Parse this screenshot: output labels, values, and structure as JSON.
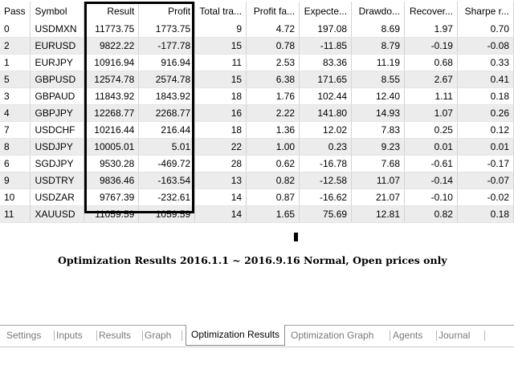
{
  "columns": [
    "Pass",
    "Symbol",
    "Result",
    "Profit",
    "Total tra...",
    "Profit fa...",
    "Expecte...",
    "Drawdo...",
    "Recover...",
    "Sharpe r..."
  ],
  "rows": [
    [
      "0",
      "USDMXN",
      "11773.75",
      "1773.75",
      "9",
      "4.72",
      "197.08",
      "8.69",
      "1.97",
      "0.70"
    ],
    [
      "2",
      "EURUSD",
      "9822.22",
      "-177.78",
      "15",
      "0.78",
      "-11.85",
      "8.79",
      "-0.19",
      "-0.08"
    ],
    [
      "1",
      "EURJPY",
      "10916.94",
      "916.94",
      "11",
      "2.53",
      "83.36",
      "11.19",
      "0.68",
      "0.33"
    ],
    [
      "5",
      "GBPUSD",
      "12574.78",
      "2574.78",
      "15",
      "6.38",
      "171.65",
      "8.55",
      "2.67",
      "0.41"
    ],
    [
      "3",
      "GBPAUD",
      "11843.92",
      "1843.92",
      "18",
      "1.76",
      "102.44",
      "12.40",
      "1.11",
      "0.18"
    ],
    [
      "4",
      "GBPJPY",
      "12268.77",
      "2268.77",
      "16",
      "2.22",
      "141.80",
      "14.93",
      "1.07",
      "0.26"
    ],
    [
      "7",
      "USDCHF",
      "10216.44",
      "216.44",
      "18",
      "1.36",
      "12.02",
      "7.83",
      "0.25",
      "0.12"
    ],
    [
      "8",
      "USDJPY",
      "10005.01",
      "5.01",
      "22",
      "1.00",
      "0.23",
      "9.23",
      "0.01",
      "0.01"
    ],
    [
      "6",
      "SGDJPY",
      "9530.28",
      "-469.72",
      "28",
      "0.62",
      "-16.78",
      "7.68",
      "-0.61",
      "-0.17"
    ],
    [
      "9",
      "USDTRY",
      "9836.46",
      "-163.54",
      "13",
      "0.82",
      "-12.58",
      "11.07",
      "-0.14",
      "-0.07"
    ],
    [
      "10",
      "USDZAR",
      "9767.39",
      "-232.61",
      "14",
      "0.87",
      "-16.62",
      "21.07",
      "-0.10",
      "-0.02"
    ],
    [
      "11",
      "XAUUSD",
      "11059.59",
      "1059.59",
      "14",
      "1.65",
      "75.69",
      "12.81",
      "0.82",
      "0.18"
    ]
  ],
  "caption": "Optimization Results 2016.1.1 ~ 2016.9.16 Normal, Open prices only",
  "tabs": [
    "Settings",
    "Inputs",
    "Results",
    "Graph",
    "Optimization Results",
    "Optimization Graph",
    "Agents",
    "Journal"
  ],
  "active_tab": "Optimization Results",
  "colors": {
    "row_alt": "#ececec",
    "highlight_border": "#000000",
    "tab_inactive_text": "#7a7a7a"
  }
}
